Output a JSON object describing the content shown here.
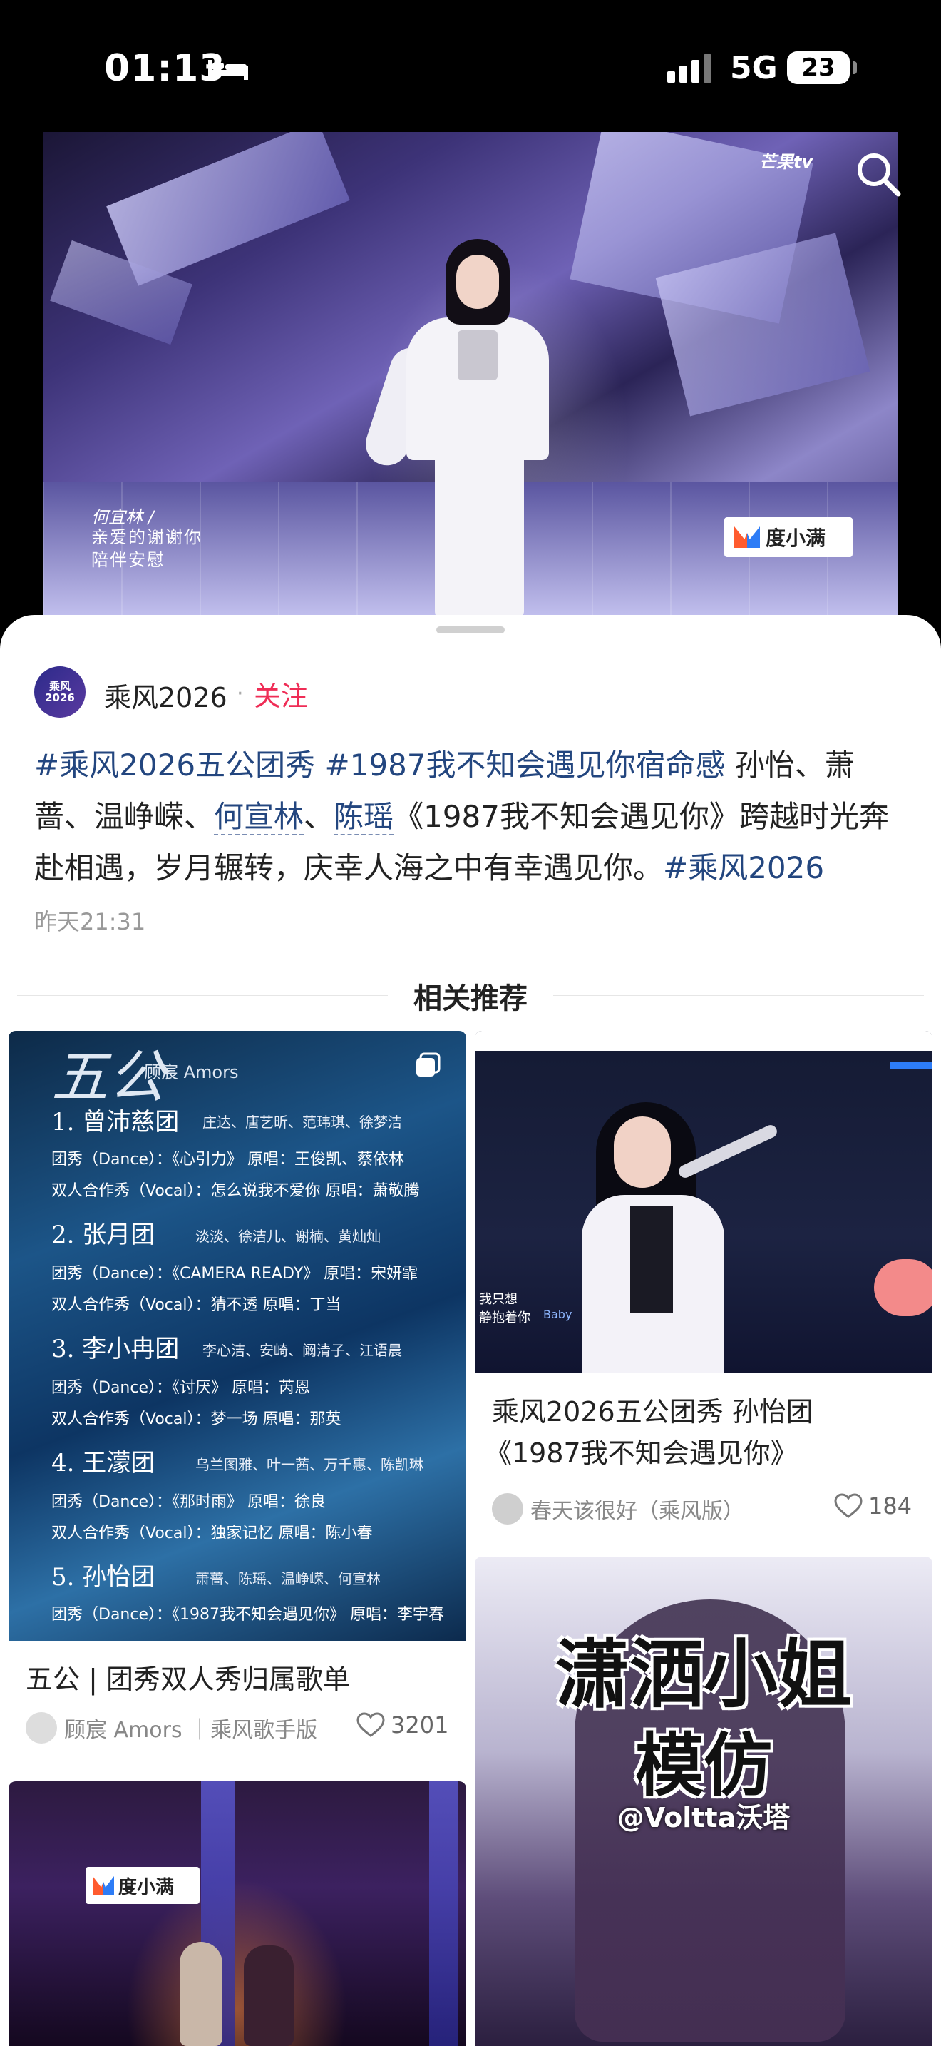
{
  "status_bar": {
    "time": "01:13",
    "network": "5G",
    "battery": "23"
  },
  "video": {
    "watermark": "芒果tv",
    "subtitle_name": "何宜林 /",
    "subtitle_lines": [
      "亲爱的谢谢你",
      "陪伴安慰"
    ],
    "sponsor": "度小满"
  },
  "post": {
    "account_name": "乘风2026",
    "avatar_text": "乘风\n2026",
    "follow_label": "关注",
    "tag1": "#乘风2026五公团秀",
    "tag2": "#1987我不知会遇见你宿命感",
    "text1": " 孙怡、萧蔷、温峥嵘、",
    "mention1": "何宣林",
    "sep": "、",
    "mention2": "陈瑶",
    "text2": "《1987我不知会遇见你》跨越时光奔赴相遇，岁月辗转，庆幸人海之中有幸遇见你。",
    "tag3": "#乘风2026",
    "time": "昨天21:31"
  },
  "related_title": "相关推荐",
  "cards": [
    {
      "title": "五公 | 团秀双人秀归属歌单",
      "author": "顾宸 Amors ｜乘风歌手版",
      "likes": "3201",
      "thumb": {
        "heading": "五公",
        "heading_sub": "顾宸 Amors",
        "teams": [
          {
            "name": "1. 曾沛慈团",
            "members": "庄达、唐艺昕、范玮琪、徐梦洁",
            "dance": "团秀（Dance）：《心引力》 原唱：王俊凯、蔡依林",
            "vocal": "双人合作秀（Vocal）：怎么说我不爱你 原唱：萧敬腾"
          },
          {
            "name": "2. 张月团",
            "members": "淡淡、徐洁儿、谢楠、黄灿灿",
            "dance": "团秀（Dance）：《CAMERA READY》 原唱：宋妍霏",
            "vocal": "双人合作秀（Vocal）：猜不透 原唱：丁当"
          },
          {
            "name": "3. 李小冉团",
            "members": "李心洁、安崎、阚清子、江语晨",
            "dance": "团秀（Dance）：《讨厌》 原唱：芮恩",
            "vocal": "双人合作秀（Vocal）：梦一场 原唱：那英"
          },
          {
            "name": "4. 王濛团",
            "members": "乌兰图雅、叶一茜、万千惠、陈凯琳",
            "dance": "团秀（Dance）：《那时雨》 原唱：徐良",
            "vocal": "双人合作秀（Vocal）：独家记忆 原唱：陈小春"
          },
          {
            "name": "5. 孙怡团",
            "members": "萧蔷、陈瑶、温峥嵘、何宣林",
            "dance": "团秀（Dance）：《1987我不知会遇见你》 原唱：李宇春",
            "vocal": ""
          }
        ]
      }
    },
    {
      "title": "乘风2026五公团秀 孙怡团《1987我不知会遇见你》",
      "title_line1": "乘风2026五公团秀 孙怡团",
      "title_line2": "《1987我不知会遇见你》",
      "author": "春天该很好（乘风版）",
      "likes": "184",
      "thumb": {
        "subtitle_lines": [
          "我只想",
          "静抱着你",
          "Baby"
        ]
      }
    },
    {
      "thumb": {
        "big1": "潇洒小姐",
        "big2": "模仿",
        "handle": "@Voltta沃塔"
      }
    },
    {
      "thumb": {
        "sponsor": "度小满"
      }
    }
  ]
}
